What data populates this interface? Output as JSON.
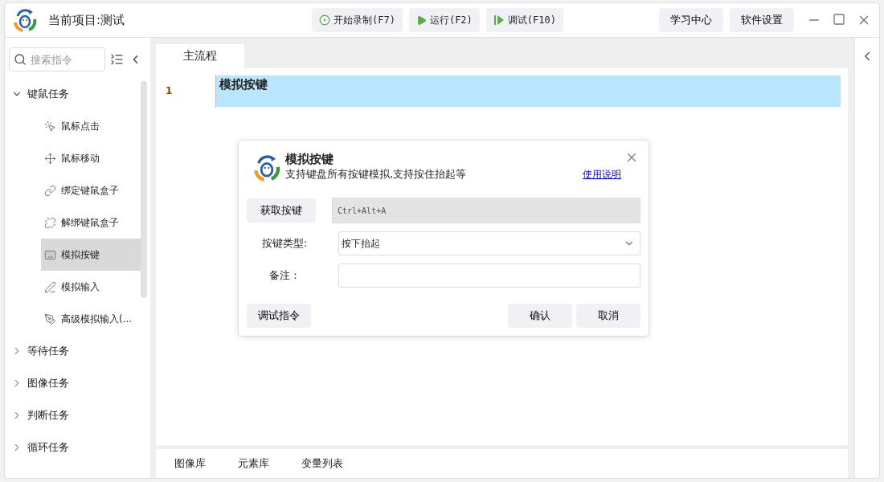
{
  "window": {
    "title": "当前项目:测试"
  },
  "toolbar": [
    {
      "kind": "record",
      "label": "开始录制(F7)"
    },
    {
      "kind": "run",
      "label": "运行(F2)"
    },
    {
      "kind": "debug",
      "label": "调试(F10)"
    }
  ],
  "header_buttons": [
    "学习中心",
    "软件设置"
  ],
  "sidebar": {
    "search": {
      "placeholder": "搜索指令"
    },
    "groups": [
      {
        "label": "键鼠任务",
        "expanded": true,
        "children": [
          {
            "kind": "click",
            "label": "鼠标点击",
            "selected": false
          },
          {
            "kind": "move",
            "label": "鼠标移动",
            "selected": false
          },
          {
            "kind": "link",
            "label": "绑定键鼠盒子",
            "selected": false
          },
          {
            "kind": "unlink",
            "label": "解绑键鼠盒子",
            "selected": false
          },
          {
            "kind": "keyboard",
            "label": "模拟按键",
            "selected": true
          },
          {
            "kind": "pen",
            "label": "模拟输入",
            "selected": false
          },
          {
            "kind": "quill",
            "label": "高级模拟输入(...",
            "selected": false
          }
        ]
      },
      {
        "label": "等待任务",
        "expanded": false
      },
      {
        "label": "图像任务",
        "expanded": false
      },
      {
        "label": "判断任务",
        "expanded": false
      },
      {
        "label": "循环任务",
        "expanded": false
      }
    ]
  },
  "editor": {
    "tabs": [
      {
        "label": "主流程",
        "selected": true
      }
    ],
    "lines": [
      {
        "number": "1",
        "text": "模拟按键",
        "selected": true
      }
    ]
  },
  "bottom_tabs": [
    "图像库",
    "元素库",
    "变量列表"
  ],
  "dialog": {
    "title": "模拟按键",
    "subtitle": "支持键盘所有按键模拟,支持按住抬起等",
    "help_link": "使用说明",
    "capture_button": "获取按键",
    "key_value": "Ctrl+Alt+A",
    "fields": [
      {
        "kind": "select",
        "label": "按键类型:",
        "value": "按下抬起"
      },
      {
        "kind": "text",
        "label": "备注："
      }
    ],
    "buttons": [
      {
        "kind": "debug",
        "label": "调试指令"
      },
      {
        "kind": "confirm",
        "label": "确认"
      },
      {
        "kind": "cancel",
        "label": "取消"
      }
    ]
  }
}
